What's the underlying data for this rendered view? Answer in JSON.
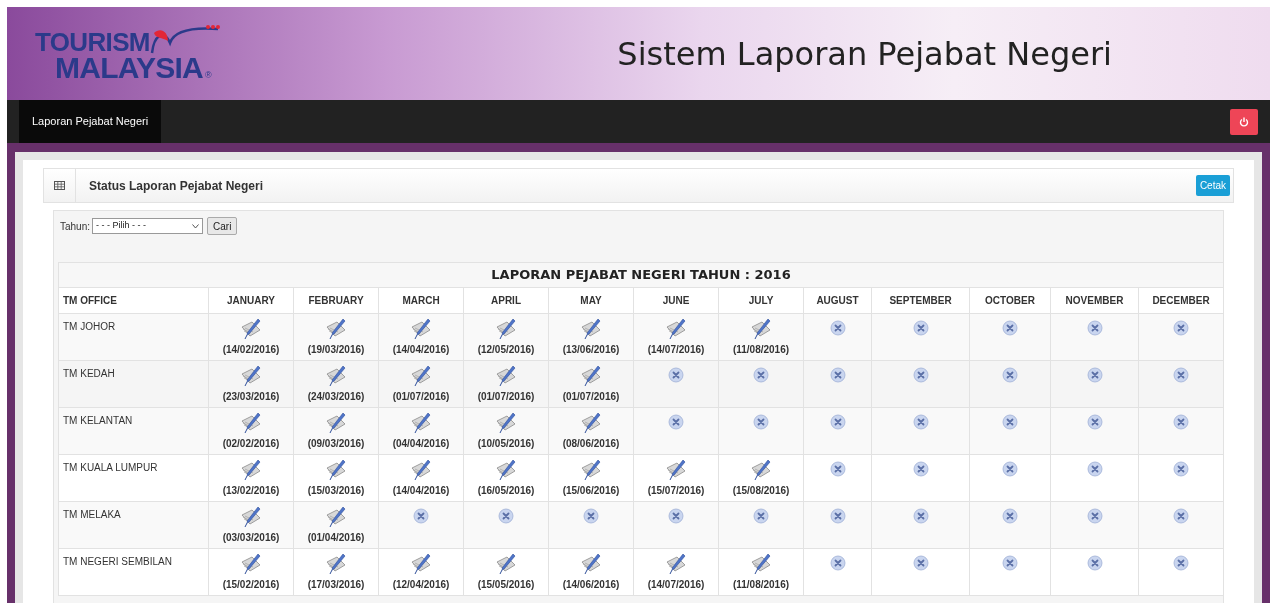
{
  "logo": {
    "line_1": "TOURISM",
    "line_2": "MALAYSIA",
    "mark": "®"
  },
  "header_title": "Sistem Laporan Pejabat Negeri",
  "nav": [
    {
      "label": "Laporan Pejabat Negeri",
      "selected": true
    }
  ],
  "panel": {
    "title": "Status Laporan Pejabat Negeri",
    "print_button": "Cetak"
  },
  "filter": {
    "label": "Tahun:",
    "select_value": "- - - Pilih - - -",
    "search_button": "Cari"
  },
  "table": {
    "caption": "LAPORAN PEJABAT NEGERI TAHUN : 2016",
    "columns": [
      "TM OFFICE",
      "JANUARY",
      "FEBRUARY",
      "MARCH",
      "APRIL",
      "MAY",
      "JUNE",
      "JULY",
      "AUGUST",
      "SEPTEMBER",
      "OCTOBER",
      "NOVEMBER",
      "DECEMBER"
    ],
    "rows": [
      {
        "cells": [
          {
            "kind": "office",
            "text": "TM JOHOR"
          },
          {
            "kind": "submitted",
            "date": "(14/02/2016)"
          },
          {
            "kind": "submitted",
            "date": "(19/03/2016)"
          },
          {
            "kind": "submitted",
            "date": "(14/04/2016)"
          },
          {
            "kind": "submitted",
            "date": "(12/05/2016)"
          },
          {
            "kind": "submitted",
            "date": "(13/06/2016)"
          },
          {
            "kind": "submitted",
            "date": "(14/07/2016)"
          },
          {
            "kind": "submitted",
            "date": "(11/08/2016)"
          },
          {
            "kind": "missing"
          },
          {
            "kind": "missing"
          },
          {
            "kind": "missing"
          },
          {
            "kind": "missing"
          },
          {
            "kind": "missing"
          }
        ]
      },
      {
        "cells": [
          {
            "kind": "office",
            "text": "TM KEDAH"
          },
          {
            "kind": "submitted",
            "date": "(23/03/2016)"
          },
          {
            "kind": "submitted",
            "date": "(24/03/2016)"
          },
          {
            "kind": "submitted",
            "date": "(01/07/2016)"
          },
          {
            "kind": "submitted",
            "date": "(01/07/2016)"
          },
          {
            "kind": "submitted",
            "date": "(01/07/2016)"
          },
          {
            "kind": "missing"
          },
          {
            "kind": "missing"
          },
          {
            "kind": "missing"
          },
          {
            "kind": "missing"
          },
          {
            "kind": "missing"
          },
          {
            "kind": "missing"
          },
          {
            "kind": "missing"
          }
        ]
      },
      {
        "cells": [
          {
            "kind": "office",
            "text": "TM KELANTAN"
          },
          {
            "kind": "submitted",
            "date": "(02/02/2016)"
          },
          {
            "kind": "submitted",
            "date": "(09/03/2016)"
          },
          {
            "kind": "submitted",
            "date": "(04/04/2016)"
          },
          {
            "kind": "submitted",
            "date": "(10/05/2016)"
          },
          {
            "kind": "submitted",
            "date": "(08/06/2016)"
          },
          {
            "kind": "missing"
          },
          {
            "kind": "missing"
          },
          {
            "kind": "missing"
          },
          {
            "kind": "missing"
          },
          {
            "kind": "missing"
          },
          {
            "kind": "missing"
          },
          {
            "kind": "missing"
          }
        ]
      },
      {
        "cells": [
          {
            "kind": "office",
            "text": "TM KUALA LUMPUR"
          },
          {
            "kind": "submitted",
            "date": "(13/02/2016)"
          },
          {
            "kind": "submitted",
            "date": "(15/03/2016)"
          },
          {
            "kind": "submitted",
            "date": "(14/04/2016)"
          },
          {
            "kind": "submitted",
            "date": "(16/05/2016)"
          },
          {
            "kind": "submitted",
            "date": "(15/06/2016)"
          },
          {
            "kind": "submitted",
            "date": "(15/07/2016)"
          },
          {
            "kind": "submitted",
            "date": "(15/08/2016)"
          },
          {
            "kind": "missing"
          },
          {
            "kind": "missing"
          },
          {
            "kind": "missing"
          },
          {
            "kind": "missing"
          },
          {
            "kind": "missing"
          }
        ]
      },
      {
        "cells": [
          {
            "kind": "office",
            "text": "TM MELAKA"
          },
          {
            "kind": "submitted",
            "date": "(03/03/2016)"
          },
          {
            "kind": "submitted",
            "date": "(01/04/2016)"
          },
          {
            "kind": "missing"
          },
          {
            "kind": "missing"
          },
          {
            "kind": "missing"
          },
          {
            "kind": "missing"
          },
          {
            "kind": "missing"
          },
          {
            "kind": "missing"
          },
          {
            "kind": "missing"
          },
          {
            "kind": "missing"
          },
          {
            "kind": "missing"
          },
          {
            "kind": "missing"
          }
        ]
      },
      {
        "cells": [
          {
            "kind": "office",
            "text": "TM NEGERI SEMBILAN"
          },
          {
            "kind": "submitted",
            "date": "(15/02/2016)"
          },
          {
            "kind": "submitted",
            "date": "(17/03/2016)"
          },
          {
            "kind": "submitted",
            "date": "(12/04/2016)"
          },
          {
            "kind": "submitted",
            "date": "(15/05/2016)"
          },
          {
            "kind": "submitted",
            "date": "(14/06/2016)"
          },
          {
            "kind": "submitted",
            "date": "(14/07/2016)"
          },
          {
            "kind": "submitted",
            "date": "(11/08/2016)"
          },
          {
            "kind": "missing"
          },
          {
            "kind": "missing"
          },
          {
            "kind": "missing"
          },
          {
            "kind": "missing"
          },
          {
            "kind": "missing"
          }
        ]
      }
    ]
  }
}
